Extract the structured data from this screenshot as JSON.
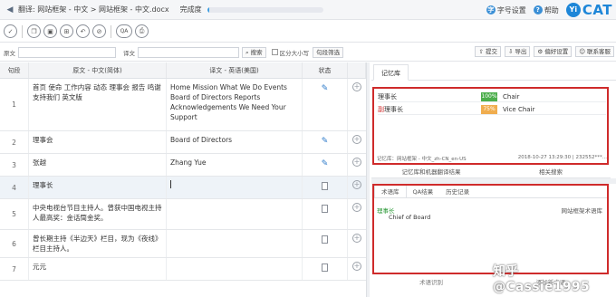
{
  "titlebar": {
    "back_arrow": "◀",
    "path": "翻译: 网站框架 - 中文 > 网站框架 - 中文.docx",
    "done_label": "完成度",
    "progress": 0.02,
    "font_settings": "字号设置",
    "help": "帮助",
    "brand_mark": "Yi",
    "brand_word": "CAT"
  },
  "toolbar": {
    "qa_label": "QA"
  },
  "filterbar": {
    "source_label": "原文",
    "target_label": "译文",
    "search_btn": "搜索",
    "case_label": "区分大小写",
    "segment_filter": "句段筛选",
    "submit_btn": "提交",
    "export_btn": "导出",
    "prefs_btn": "偏好设置",
    "contact_btn": "联系客服"
  },
  "table": {
    "headers": {
      "num": "句段",
      "source": "原文 - 中文(简体)",
      "target": "译文 - 英语(美国)",
      "status": "状态"
    },
    "rows": [
      {
        "num": "1",
        "source": "首页 使命 工作内容 动态 理事会 报告 鸣谢 支持我们 英文版",
        "target": "Home Mission What We Do Events Board of Directors Reports Acknowledgements We Need Your Support"
      },
      {
        "num": "2",
        "source": "理事会",
        "target": "Board of Directors"
      },
      {
        "num": "3",
        "source": "张越",
        "target": "Zhang Yue"
      },
      {
        "num": "4",
        "source": "理事长",
        "target": ""
      },
      {
        "num": "5",
        "source": "中央电视台节目主持人。曾获中国电视主持人最高奖：金话筒金奖。",
        "target": ""
      },
      {
        "num": "6",
        "source": "曾长期主持《半边天》栏目，现为《夜线》栏目主持人。",
        "target": ""
      },
      {
        "num": "7",
        "source": "元元",
        "target": ""
      }
    ]
  },
  "memory": {
    "tab_label": "记忆库",
    "rows": [
      {
        "source": "理事长",
        "highlight": "",
        "pct": "100%",
        "pct_color": "#4cae4c",
        "target": "Chair"
      },
      {
        "source": "理事长",
        "highlight": "副",
        "pct": "75%",
        "pct_color": "#f0ad4e",
        "target": "Vice Chair"
      }
    ],
    "meta_left": "记忆库：网站框架 - 中文_zh-CN_en-US",
    "meta_right": "2018-10-27 13:29:30 | 232552***...",
    "subtab_left": "记忆库和机器翻译结果",
    "subtab_right": "相关搜索"
  },
  "termbase": {
    "tabs": [
      "术语库",
      "QA结果",
      "历史记录"
    ],
    "term_source": "理事长",
    "term_target": "Chief of Board",
    "library": "网站框架术语库",
    "subtab_left": "术语识别",
    "subtab_right": "添加新术语"
  },
  "watermark": "知乎 @Cassie1995"
}
